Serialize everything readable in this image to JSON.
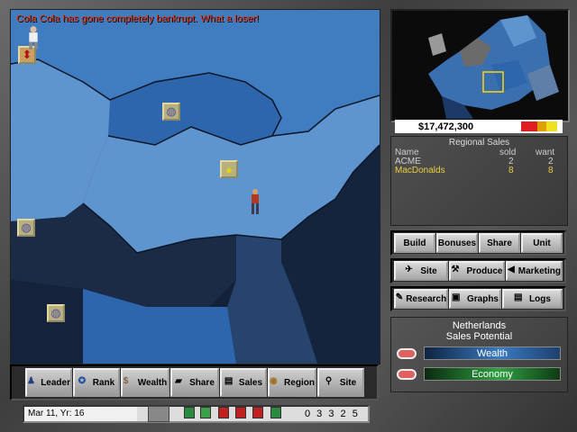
{
  "message": "Cola Cola has gone completely bankrupt.  What a loser!",
  "money": "$17,472,300",
  "regional_sales": {
    "title": "Regional Sales",
    "headers": {
      "name": "Name",
      "sold": "sold",
      "want": "want"
    },
    "rows": [
      {
        "name": "ACME",
        "sold": "2",
        "want": "2",
        "color": "#d0d0d0"
      },
      {
        "name": "MacDonalds",
        "sold": "8",
        "want": "8",
        "color": "#e8d040"
      }
    ]
  },
  "actions": {
    "row1": [
      "Build",
      "Bonuses",
      "Share",
      "Unit"
    ],
    "row2": [
      "Site",
      "Produce",
      "Marketing"
    ],
    "row3": [
      "Research",
      "Graphs",
      "Logs"
    ]
  },
  "region": {
    "name": "Netherlands",
    "subtitle": "Sales Potential",
    "sliders": [
      {
        "label": "Wealth",
        "icon": "toggle-icon"
      },
      {
        "label": "Economy",
        "icon": "toggle-icon"
      }
    ]
  },
  "toolbar": [
    "Leader",
    "Rank",
    "Wealth",
    "Share",
    "Sales",
    "Region",
    "Site"
  ],
  "status": {
    "date": "Mar 11, Yr: 16",
    "digits": "0 3 3 2 5"
  },
  "colors": {
    "map_light": "#5e95cf",
    "map_mid": "#2e66ad",
    "map_dark": "#1a2a44",
    "message": "#e23a1a"
  }
}
